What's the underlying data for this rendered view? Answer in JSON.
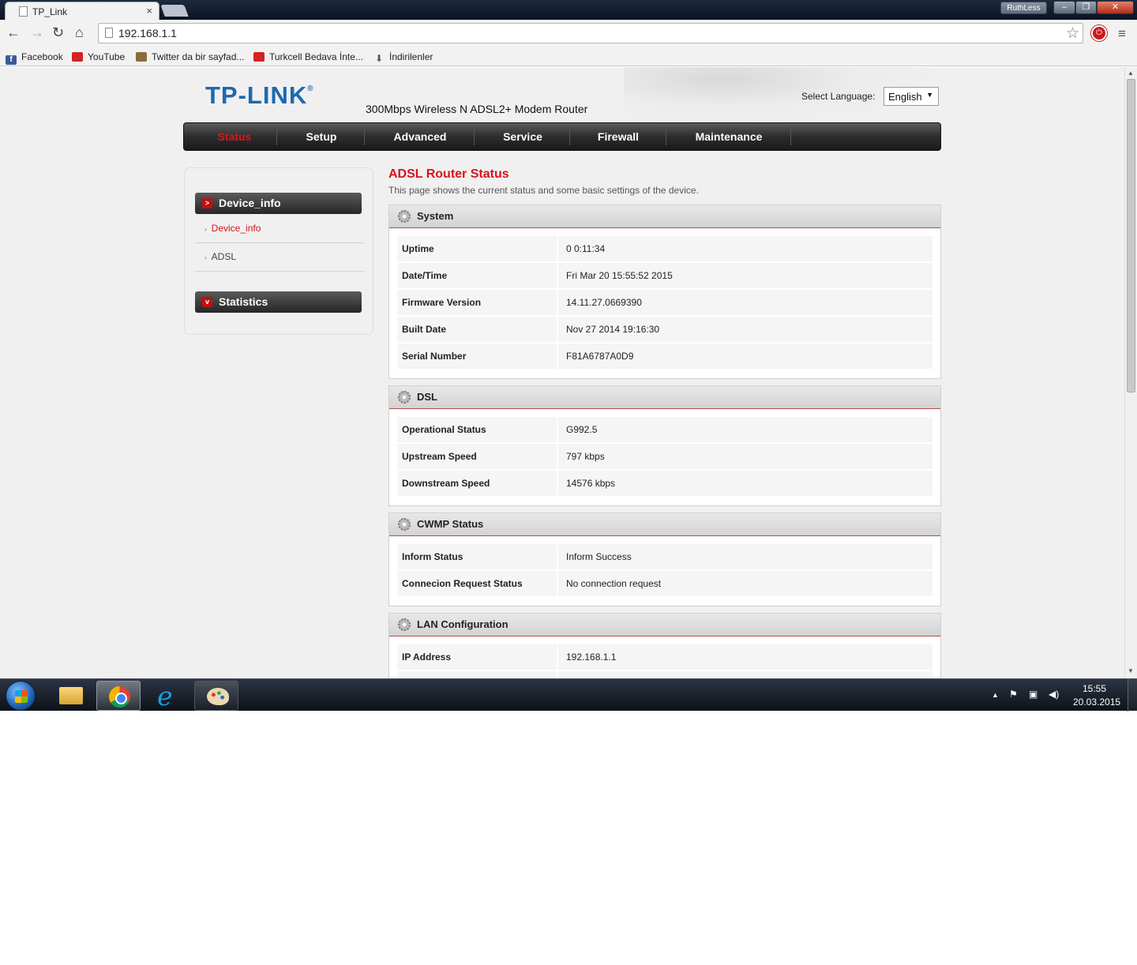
{
  "browser": {
    "tab_title": "TP_Link",
    "tab_close": "×",
    "profile_name": "RuthLess",
    "url": "192.168.1.1",
    "bookmarks": [
      {
        "label": "Facebook",
        "icon": "facebook-icon"
      },
      {
        "label": "YouTube",
        "icon": "youtube-icon"
      },
      {
        "label": "Twitter da bir sayfad...",
        "icon": "bookmark-page-icon"
      },
      {
        "label": "Turkcell Bedava İnte...",
        "icon": "youtube-icon"
      },
      {
        "label": "İndirilenler",
        "icon": "download-icon"
      }
    ]
  },
  "router": {
    "brand": "TP-LINK",
    "brand_mark": "®",
    "model": "300Mbps Wireless N ADSL2+ Modem Router",
    "language_label": "Select Language:",
    "language_value": "English",
    "nav": [
      "Status",
      "Setup",
      "Advanced",
      "Service",
      "Firewall",
      "Maintenance"
    ],
    "active_nav": "Status",
    "sidebar": {
      "group1": "Device_info",
      "items": [
        "Device_info",
        "ADSL"
      ],
      "group2": "Statistics"
    },
    "title": "ADSL Router Status",
    "description": "This page shows the current status and some basic settings of the device.",
    "sections": {
      "system": {
        "title": "System",
        "rows": [
          {
            "label": "Uptime",
            "value": "0 0:11:34"
          },
          {
            "label": "Date/Time",
            "value": "Fri Mar 20 15:55:52 2015"
          },
          {
            "label": "Firmware Version",
            "value": "14.11.27.0669390"
          },
          {
            "label": "Built Date",
            "value": "Nov 27 2014 19:16:30"
          },
          {
            "label": "Serial Number",
            "value": "F81A6787A0D9"
          }
        ]
      },
      "dsl": {
        "title": "DSL",
        "rows": [
          {
            "label": "Operational Status",
            "value": "G992.5"
          },
          {
            "label": "Upstream Speed",
            "value": "797 kbps"
          },
          {
            "label": "Downstream Speed",
            "value": "14576 kbps"
          }
        ]
      },
      "cwmp": {
        "title": "CWMP Status",
        "rows": [
          {
            "label": "Inform Status",
            "value": "Inform Success"
          },
          {
            "label": "Connecion Request Status",
            "value": "No connection request"
          }
        ]
      },
      "lan": {
        "title": "LAN Configuration",
        "rows": [
          {
            "label": "IP Address",
            "value": "192.168.1.1"
          }
        ]
      }
    }
  },
  "taskbar": {
    "time": "15:55",
    "date": "20.03.2015"
  },
  "colors": {
    "accent_red": "#d8131a",
    "brand_blue": "#1f68b0"
  }
}
